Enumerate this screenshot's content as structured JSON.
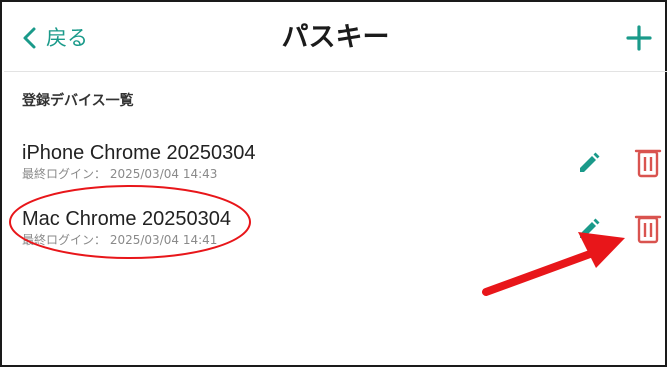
{
  "header": {
    "back_label": "戻る",
    "title": "パスキー",
    "add_icon": "plus-icon"
  },
  "section": {
    "title": "登録デバイス一覧"
  },
  "devices": [
    {
      "name": "iPhone Chrome 20250304",
      "last_login_label": "最終ログイン：",
      "last_login_value": "2025/03/04 14:43",
      "edit_icon": "pencil-icon",
      "delete_icon": "trash-icon"
    },
    {
      "name": "Mac Chrome 20250304",
      "last_login_label": "最終ログイン：",
      "last_login_value": "2025/03/04 14:41",
      "edit_icon": "pencil-icon",
      "delete_icon": "trash-icon"
    }
  ],
  "colors": {
    "accent": "#1a9a8a",
    "delete": "#d9534f",
    "annotation": "#e8161a"
  }
}
